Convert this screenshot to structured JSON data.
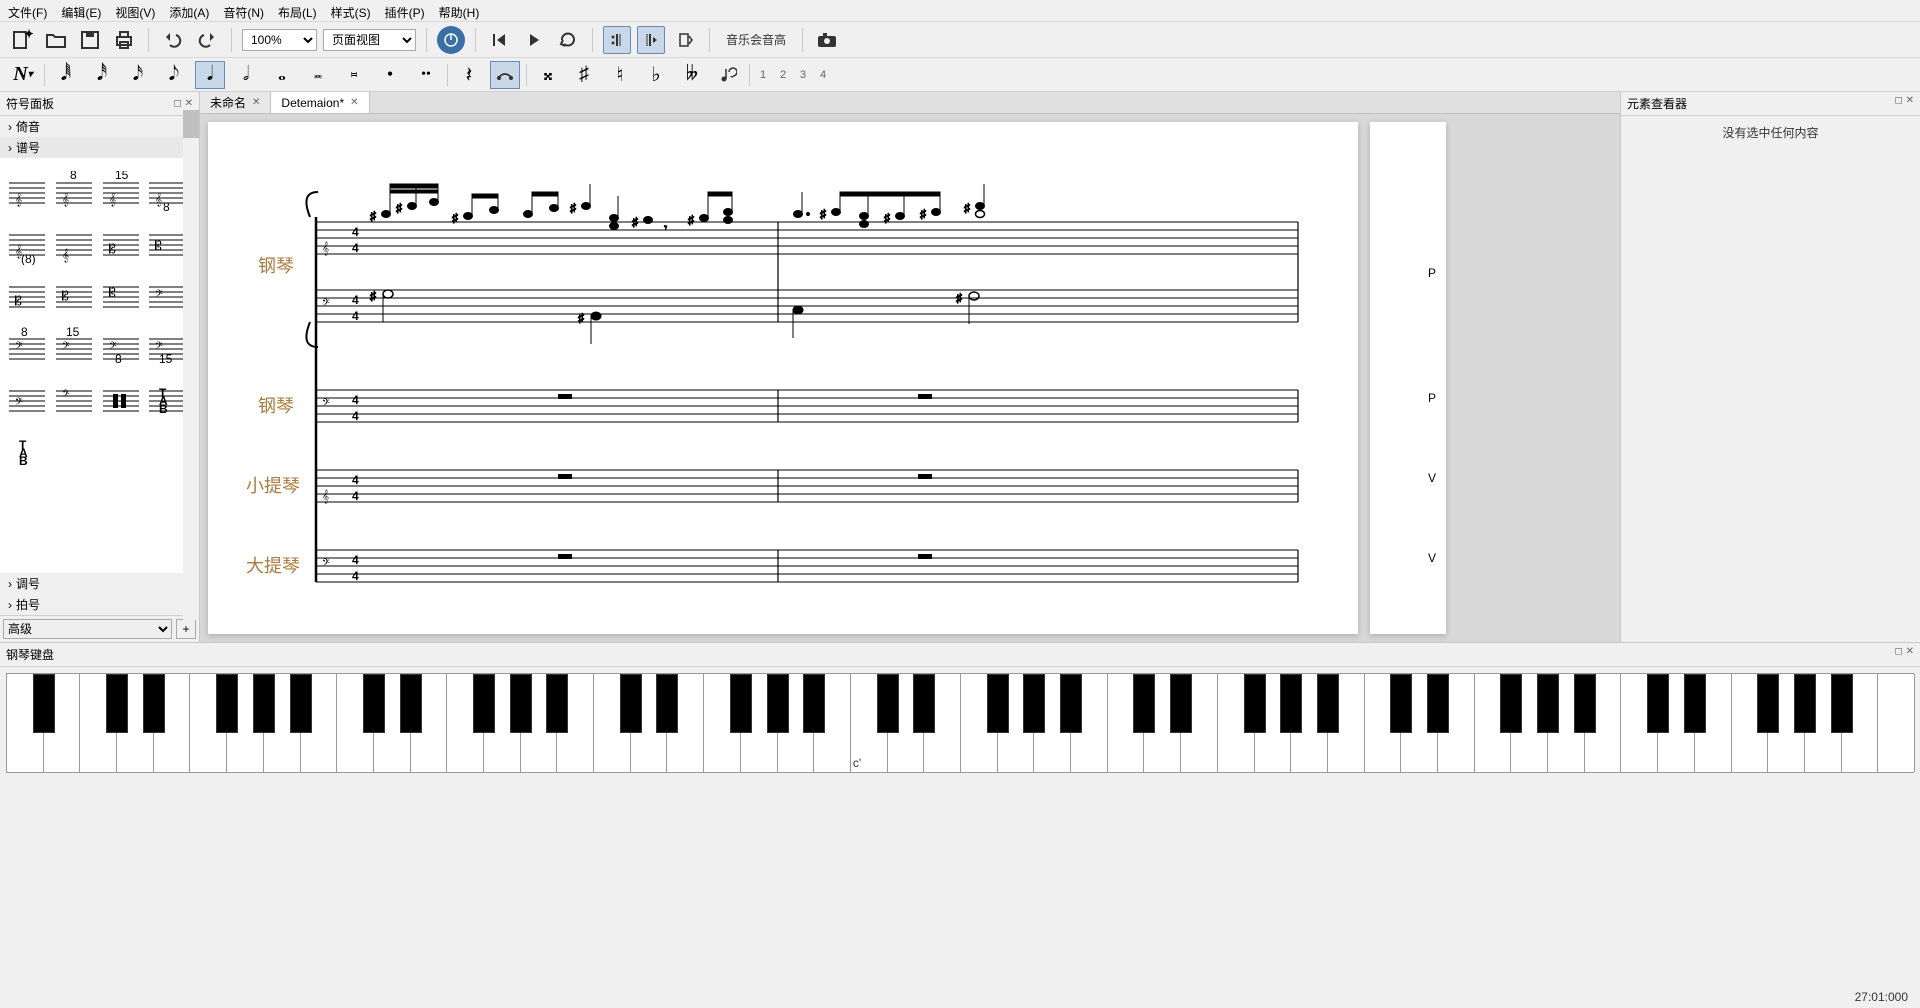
{
  "menu": {
    "file": "文件(F)",
    "edit": "编辑(E)",
    "view": "视图(V)",
    "add": "添加(A)",
    "notes": "音符(N)",
    "layout": "布局(L)",
    "style": "样式(S)",
    "plugins": "插件(P)",
    "help": "帮助(H)"
  },
  "toolbar": {
    "zoom": "100%",
    "view_mode": "页面视图",
    "concert_pitch": "音乐会音高"
  },
  "voice_numbers": [
    "1",
    "2",
    "3",
    "4"
  ],
  "palette": {
    "title": "符号面板",
    "sec_grace": "倚音",
    "sec_clef": "谱号",
    "sec_key": "调号",
    "sec_time": "拍号",
    "footer_select": "高级"
  },
  "tabs": [
    {
      "label": "未命名",
      "active": false
    },
    {
      "label": "Detemaion*",
      "active": true
    }
  ],
  "instruments": {
    "piano1": "钢琴",
    "piano2": "钢琴",
    "violin": "小提琴",
    "cello": "大提琴"
  },
  "page2_labels": {
    "p1": "P",
    "p2": "P",
    "v": "V",
    "v2": "V"
  },
  "inspector": {
    "title": "元素查看器",
    "empty": "没有选中任何内容"
  },
  "piano": {
    "title": "钢琴键盘",
    "middle_c": "c'"
  },
  "status": {
    "time": "27:01:000"
  }
}
